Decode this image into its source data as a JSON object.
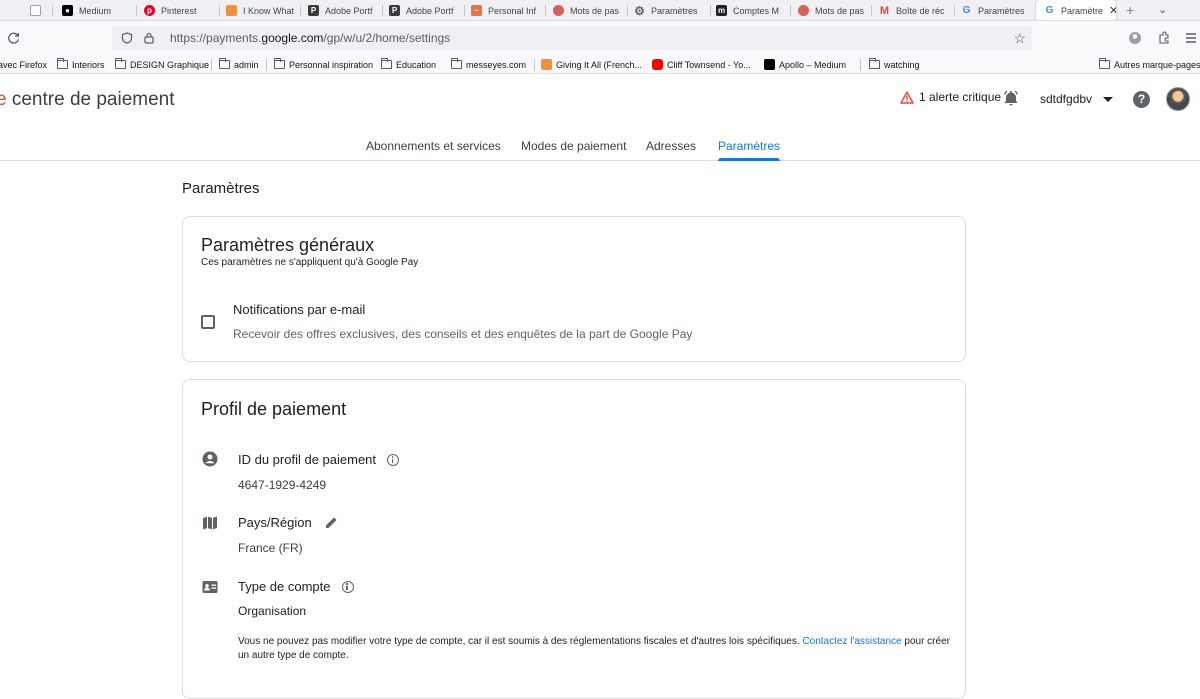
{
  "browser": {
    "tabs": [
      {
        "label": "",
        "color": "#9e9ea7"
      },
      {
        "label": "Medium",
        "color": "#000000"
      },
      {
        "label": "Pinterest",
        "color": "#e60023"
      },
      {
        "label": "I Know What",
        "color": "#f2903a"
      },
      {
        "label": "Adobe Portf",
        "color": "#3a3a3a"
      },
      {
        "label": "Adobe Portf",
        "color": "#3a3a3a"
      },
      {
        "label": "Personal Inf",
        "color": "#e8713c"
      },
      {
        "label": "Mots de pas",
        "color": "#d95f59"
      },
      {
        "label": "Paramètres",
        "color": "#5f6368"
      },
      {
        "label": "Comptes M",
        "color": "#222222"
      },
      {
        "label": "Mots de pas",
        "color": "#d95f59"
      },
      {
        "label": "Boîte de réc",
        "color": "#ea4335"
      },
      {
        "label": "Paramètres",
        "color": "#4285f4"
      },
      {
        "label": "Paramètre",
        "color": "#4285f4"
      }
    ],
    "url_prefix": "https://payments.",
    "url_domain": "google.com",
    "url_path": "/gp/w/u/2/home/settings",
    "bookmarks": [
      {
        "label": "avec Firefox",
        "kind": "none"
      },
      {
        "label": "Interiors",
        "kind": "folder"
      },
      {
        "label": "DESIGN Graphique",
        "kind": "folder"
      },
      {
        "label": "admin",
        "kind": "folder"
      },
      {
        "label": "Personnal inspiration",
        "kind": "folder"
      },
      {
        "label": "Education",
        "kind": "folder"
      },
      {
        "label": "messeyes.com",
        "kind": "folder"
      },
      {
        "label": "Giving It All (French...",
        "kind": "fav",
        "color": "#f2903a"
      },
      {
        "label": "Cliff Townsend - Yo...",
        "kind": "fav",
        "color": "#ff0000"
      },
      {
        "label": "Apollo – Medium",
        "kind": "fav",
        "color": "#000000"
      },
      {
        "label": "watching",
        "kind": "folder"
      },
      {
        "label": "Autres marque-pages",
        "kind": "folder"
      }
    ]
  },
  "header": {
    "brand_e": "e",
    "brand_rest": " centre de paiement",
    "alert_text": "1 alerte critique",
    "account_name": "sdtdfgdbv",
    "help_glyph": "?"
  },
  "nav_tabs": [
    "Abonnements et services",
    "Modes de paiement",
    "Adresses",
    "Paramètres"
  ],
  "main": {
    "page_title": "Paramètres",
    "general": {
      "title": "Paramètres généraux",
      "subtitle": "Ces paramètres ne s'appliquent qu'à Google Pay",
      "notif_title": "Notifications par e-mail",
      "notif_desc": "Recevoir des offres exclusives, des conseils et des enquêtes de la part de Google Pay",
      "notif_checked": false
    },
    "profile": {
      "title": "Profil de paiement",
      "id_label": "ID du profil de paiement",
      "id_value": "4647-1929-4249",
      "country_label": "Pays/Région",
      "country_value": "France (FR)",
      "type_label": "Type de compte",
      "type_value": "Organisation",
      "notice_text": "Vous ne pouvez pas modifier votre type de compte, car il est soumis à des réglementations fiscales et d'autres lois spécifiques. ",
      "notice_link": "Contactez l'assistance",
      "notice_end": " pour créer un autre type de compte."
    }
  },
  "colors": {
    "accent": "#1a73e8",
    "alert_red": "#ea4335"
  }
}
